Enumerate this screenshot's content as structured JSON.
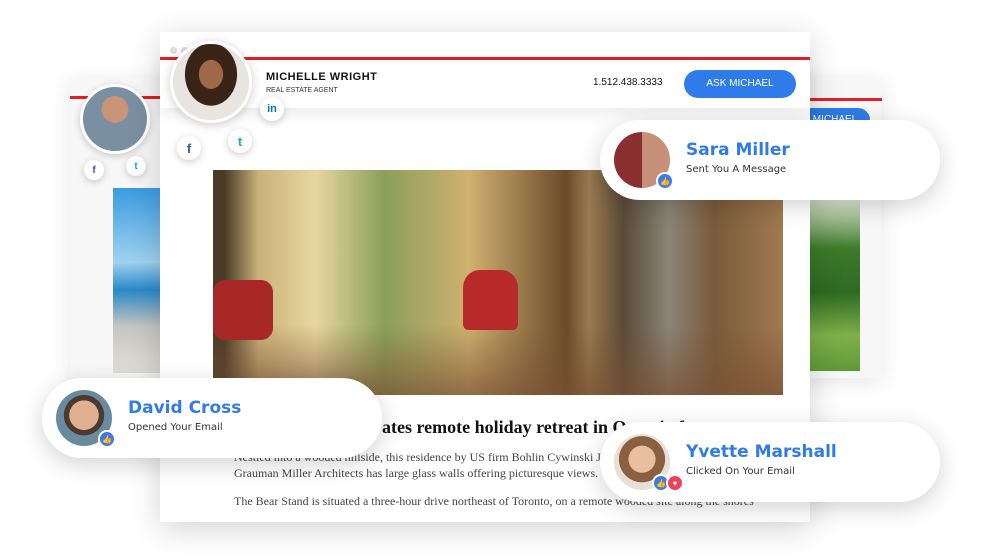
{
  "colors": {
    "accent": "#2f7bea",
    "header_line": "#e31e24"
  },
  "main_card": {
    "agent_name": "MICHELLE WRIGHT",
    "agent_title": "REAL ESTATE AGENT",
    "phone": "1.512.438.3333",
    "cta_label": "ASK MICHAEL",
    "socials": [
      {
        "icon": "linkedin-icon",
        "glyph": "in"
      },
      {
        "icon": "facebook-icon",
        "glyph": "f"
      },
      {
        "icon": "twitter-icon",
        "glyph": "t"
      }
    ],
    "headline": "ates remote holiday retreat in Ontario forest",
    "para1": "Nestled into a wooded hillside, this residence by US firm Bohlin Cywinski Jackson and",
    "para2": "Grauman Miller Architects has large glass walls offering picturesque views.",
    "para3": "The Bear Stand is situated a three-hour drive northeast of Toronto, on a remote wooded site along the shores"
  },
  "back_card_right": {
    "cta_label": "MICHAEL"
  },
  "notifications": [
    {
      "name": "Sara Miller",
      "status": "Sent You A Message",
      "reactions": [
        "like-icon"
      ]
    },
    {
      "name": "David Cross",
      "status": "Opened Your Email",
      "reactions": [
        "like-icon"
      ]
    },
    {
      "name": "Yvette Marshall",
      "status": "Clicked On Your Email",
      "reactions": [
        "like-icon",
        "heart-icon"
      ]
    }
  ]
}
